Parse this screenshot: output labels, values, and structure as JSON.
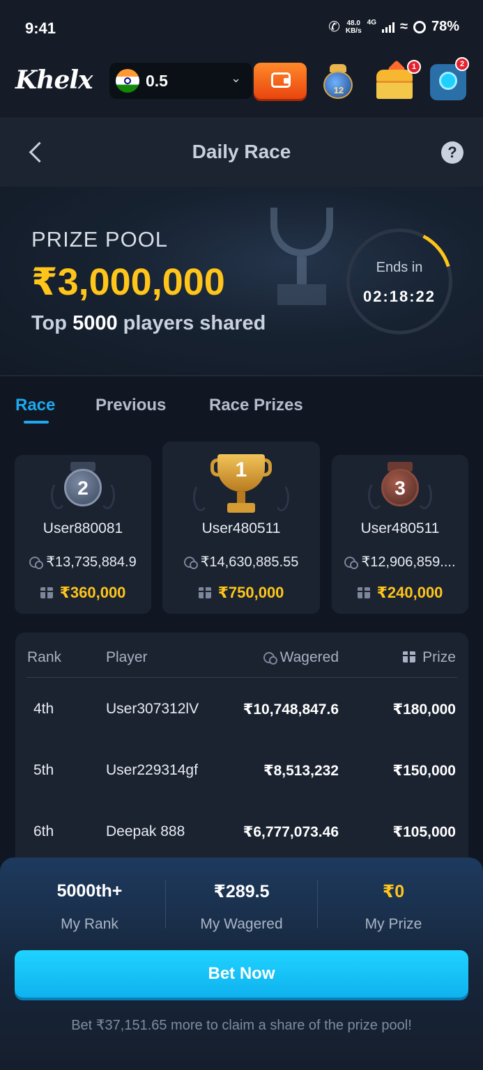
{
  "status_bar": {
    "time": "9:41",
    "net_speed": "48.0",
    "net_unit": "KB/s",
    "network": "4G",
    "battery": "78%"
  },
  "header": {
    "logo": "Khelx",
    "currency_value": "0.5",
    "jar_count": "12",
    "chest_badge": "1",
    "support_badge": "2"
  },
  "title_bar": {
    "title": "Daily Race",
    "help": "?"
  },
  "hero": {
    "prize_label": "PRIZE POOL",
    "prize_amount": "₹3,000,000",
    "sub_prefix": "Top ",
    "sub_count": "5000",
    "sub_suffix": " players shared",
    "ends_label": "Ends in",
    "ends_time": "02:18:22"
  },
  "tabs": [
    "Race",
    "Previous",
    "Race Prizes"
  ],
  "podium": [
    {
      "rank": "2",
      "user": "User880081",
      "wagered": "₹13,735,884.9",
      "prize": "₹360,000"
    },
    {
      "rank": "1",
      "user": "User480511",
      "wagered": "₹14,630,885.55",
      "prize": "₹750,000"
    },
    {
      "rank": "3",
      "user": "User480511",
      "wagered": "₹12,906,859....",
      "prize": "₹240,000"
    }
  ],
  "board": {
    "headers": {
      "rank": "Rank",
      "player": "Player",
      "wagered": "Wagered",
      "prize": "Prize"
    },
    "rows": [
      {
        "rank": "4th",
        "player": "User307312lV",
        "wagered": "₹10,748,847.6",
        "prize": "₹180,000"
      },
      {
        "rank": "5th",
        "player": "User229314gf",
        "wagered": "₹8,513,232",
        "prize": "₹150,000"
      },
      {
        "rank": "6th",
        "player": "Deepak 888",
        "wagered": "₹6,777,073.46",
        "prize": "₹105,000"
      }
    ]
  },
  "bottom": {
    "my_rank_value": "5000th+",
    "my_rank_label": "My Rank",
    "my_wagered_value": "₹289.5",
    "my_wagered_label": "My Wagered",
    "my_prize_value": "₹0",
    "my_prize_label": "My Prize",
    "bet_button": "Bet Now",
    "hint": "Bet ₹37,151.65 more to claim a share of the prize pool!"
  },
  "colors": {
    "accent_gold": "#ffc51a",
    "accent_blue": "#1ea9f0",
    "background": "#111722"
  }
}
